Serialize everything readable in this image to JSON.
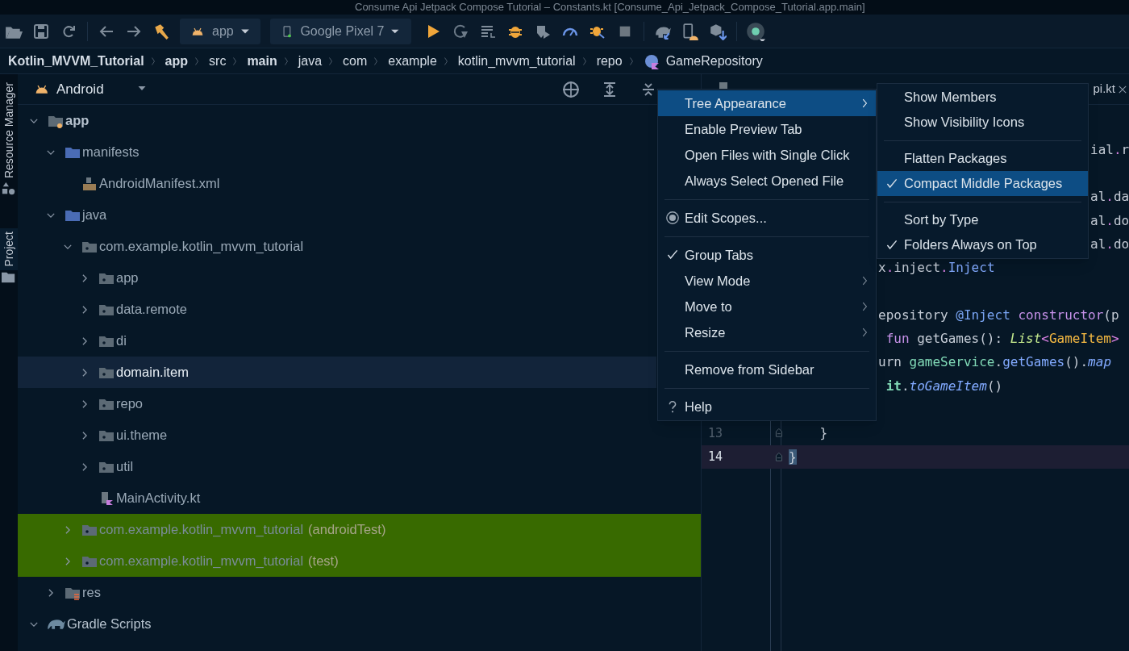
{
  "window": {
    "title": "Consume Api Jetpack Compose Tutorial – Constants.kt [Consume_Api_Jetpack_Compose_Tutorial.app.main]"
  },
  "toolbar": {
    "config": {
      "label": "app"
    },
    "device": {
      "label": "Google Pixel 7"
    }
  },
  "breadcrumbs": [
    {
      "label": "Kotlin_MVVM_Tutorial",
      "bold": true
    },
    {
      "label": "app",
      "bold": true
    },
    {
      "label": "src",
      "bold": false
    },
    {
      "label": "main",
      "bold": true
    },
    {
      "label": "java",
      "bold": false
    },
    {
      "label": "com",
      "bold": false
    },
    {
      "label": "example",
      "bold": false
    },
    {
      "label": "kotlin_mvvm_tutorial",
      "bold": false
    },
    {
      "label": "repo",
      "bold": false
    },
    {
      "label": "GameRepository",
      "bold": false,
      "kind": "class"
    }
  ],
  "side_tabs": [
    {
      "label": "Resource Manager",
      "selected": false
    },
    {
      "label": "Project",
      "selected": true
    }
  ],
  "project": {
    "view": "Android",
    "tree": [
      {
        "label": "app",
        "kind": "module",
        "expanded": true,
        "selected": false,
        "highlighted": false,
        "children": [
          {
            "label": "manifests",
            "kind": "source_folder",
            "expanded": true,
            "selected": false,
            "highlighted": false,
            "children": [
              {
                "label": "AndroidManifest.xml",
                "kind": "manifest",
                "selected": false,
                "highlighted": false
              }
            ]
          },
          {
            "label": "java",
            "kind": "source_folder",
            "expanded": true,
            "selected": false,
            "highlighted": false,
            "children": [
              {
                "label": "com.example.kotlin_mvvm_tutorial",
                "kind": "package",
                "expanded": true,
                "selected": false,
                "highlighted": false,
                "children": [
                  {
                    "label": "app",
                    "kind": "package",
                    "expanded": false,
                    "selected": false,
                    "highlighted": false
                  },
                  {
                    "label": "data.remote",
                    "kind": "package",
                    "expanded": false,
                    "selected": false,
                    "highlighted": false
                  },
                  {
                    "label": "di",
                    "kind": "package",
                    "expanded": false,
                    "selected": false,
                    "highlighted": false
                  },
                  {
                    "label": "domain.item",
                    "kind": "package",
                    "expanded": false,
                    "selected": true,
                    "highlighted": false
                  },
                  {
                    "label": "repo",
                    "kind": "package",
                    "expanded": false,
                    "selected": false,
                    "highlighted": false
                  },
                  {
                    "label": "ui.theme",
                    "kind": "package",
                    "expanded": false,
                    "selected": false,
                    "highlighted": false
                  },
                  {
                    "label": "util",
                    "kind": "package",
                    "expanded": false,
                    "selected": false,
                    "highlighted": false
                  },
                  {
                    "label": "MainActivity.kt",
                    "kind": "kotlin_file",
                    "selected": false,
                    "highlighted": false
                  }
                ]
              },
              {
                "label": "com.example.kotlin_mvvm_tutorial",
                "suffix": "(androidTest)",
                "kind": "package",
                "expanded": false,
                "selected": false,
                "highlighted": true
              },
              {
                "label": "com.example.kotlin_mvvm_tutorial",
                "suffix": "(test)",
                "kind": "package",
                "expanded": false,
                "selected": false,
                "highlighted": true
              }
            ]
          },
          {
            "label": "res",
            "kind": "resource_folder",
            "expanded": false,
            "selected": false,
            "highlighted": false
          }
        ]
      },
      {
        "label": "Gradle Scripts",
        "kind": "gradle",
        "expanded": true,
        "selected": false,
        "highlighted": false
      }
    ]
  },
  "editor": {
    "tabs": [
      {
        "label": "pi.kt",
        "selected": false
      }
    ],
    "lines": [
      {
        "kind": "behind_submenu",
        "current": false,
        "tokens": [
          {
            "kind": "plain",
            "text": "ial"
          },
          {
            "kind": "dot",
            "text": "."
          },
          {
            "kind": "plain",
            "text": "r"
          }
        ]
      },
      {
        "kind": "blank",
        "current": false
      },
      {
        "kind": "behind_submenu",
        "current": false,
        "tokens": [
          {
            "kind": "plain",
            "text": "al"
          },
          {
            "kind": "dot",
            "text": "."
          },
          {
            "kind": "plain",
            "text": "da"
          }
        ]
      },
      {
        "kind": "behind_submenu",
        "current": false,
        "tokens": [
          {
            "kind": "plain",
            "text": "al"
          },
          {
            "kind": "dot",
            "text": "."
          },
          {
            "kind": "plain",
            "text": "do"
          }
        ]
      },
      {
        "kind": "behind_submenu",
        "current": false,
        "tokens": [
          {
            "kind": "plain",
            "text": "al"
          },
          {
            "kind": "dot",
            "text": "."
          },
          {
            "kind": "plain",
            "text": "do"
          }
        ]
      },
      {
        "kind": "behind_menu",
        "current": false,
        "tokens": [
          {
            "kind": "plain",
            "text": "x"
          },
          {
            "kind": "dot",
            "text": "."
          },
          {
            "kind": "plain",
            "text": "inject"
          },
          {
            "kind": "dot",
            "text": "."
          },
          {
            "kind": "function",
            "text": "Inject"
          }
        ]
      },
      {
        "kind": "blank",
        "current": false
      },
      {
        "kind": "behind_menu",
        "current": false,
        "tokens": [
          {
            "kind": "plain",
            "text": "epository "
          },
          {
            "kind": "annotation",
            "text": "@Inject"
          },
          {
            "kind": "keyword",
            "text": " constructor"
          },
          {
            "kind": "plain",
            "text": "(p"
          }
        ]
      },
      {
        "kind": "behind_menu",
        "current": false,
        "tokens": [
          {
            "kind": "keyword",
            "text": " fun"
          },
          {
            "kind": "plain",
            "text": " getGames(): "
          },
          {
            "kind": "type_italic",
            "text": "List"
          },
          {
            "kind": "dot",
            "text": "<"
          },
          {
            "kind": "type",
            "text": "GameItem"
          },
          {
            "kind": "dot",
            "text": ">"
          }
        ]
      },
      {
        "kind": "behind_menu",
        "current": false,
        "tokens": [
          {
            "kind": "plain",
            "text": "urn "
          },
          {
            "kind": "property",
            "text": "gameService"
          },
          {
            "kind": "plain",
            "text": "."
          },
          {
            "kind": "function",
            "text": "getGames"
          },
          {
            "kind": "plain",
            "text": "()."
          },
          {
            "kind": "function_italic",
            "text": "map"
          }
        ]
      },
      {
        "kind": "behind_menu",
        "current": false,
        "tokens": [
          {
            "kind": "property_bold",
            "text": " it"
          },
          {
            "kind": "plain",
            "text": "."
          },
          {
            "kind": "function_italic",
            "text": "toGameItem"
          },
          {
            "kind": "plain",
            "text": "()"
          }
        ]
      },
      {
        "kind": "blank",
        "current": false
      },
      {
        "kind": "plain",
        "number": "13",
        "fold": true,
        "current": false,
        "tokens": [
          {
            "kind": "plain",
            "text": "    }"
          }
        ]
      },
      {
        "kind": "plain",
        "number": "14",
        "fold": true,
        "current": true,
        "tokens": [
          {
            "kind": "bracket_match",
            "text": "}"
          }
        ]
      }
    ]
  },
  "context_menu": {
    "groups": [
      [
        {
          "label": "Tree Appearance",
          "selected": true,
          "checked": false,
          "submenu": true
        },
        {
          "label": "Enable Preview Tab",
          "selected": false,
          "checked": false,
          "submenu": false
        },
        {
          "label": "Open Files with Single Click",
          "selected": false,
          "checked": false,
          "submenu": false
        },
        {
          "label": "Always Select Opened File",
          "selected": false,
          "checked": false,
          "submenu": false
        }
      ],
      [
        {
          "label": "Edit Scopes...",
          "selected": false,
          "checked": false,
          "submenu": false,
          "kind": "scope"
        }
      ],
      [
        {
          "label": "Group Tabs",
          "selected": false,
          "checked": true,
          "submenu": false
        },
        {
          "label": "View Mode",
          "selected": false,
          "checked": false,
          "submenu": true
        },
        {
          "label": "Move to",
          "selected": false,
          "checked": false,
          "submenu": true
        },
        {
          "label": "Resize",
          "selected": false,
          "checked": false,
          "submenu": true
        }
      ],
      [
        {
          "label": "Remove from Sidebar",
          "selected": false,
          "checked": false,
          "submenu": false
        }
      ],
      [
        {
          "label": "Help",
          "selected": false,
          "checked": false,
          "submenu": false,
          "kind": "help"
        }
      ]
    ]
  },
  "submenu": {
    "groups": [
      [
        {
          "label": "Show Members",
          "selected": false,
          "checked": false
        },
        {
          "label": "Show Visibility Icons",
          "selected": false,
          "checked": false
        }
      ],
      [
        {
          "label": "Flatten Packages",
          "selected": false,
          "checked": false
        },
        {
          "label": "Compact Middle Packages",
          "selected": true,
          "checked": true
        }
      ],
      [
        {
          "label": "Sort by Type",
          "selected": false,
          "checked": false
        },
        {
          "label": "Folders Always on Top",
          "selected": false,
          "checked": true
        }
      ]
    ]
  }
}
